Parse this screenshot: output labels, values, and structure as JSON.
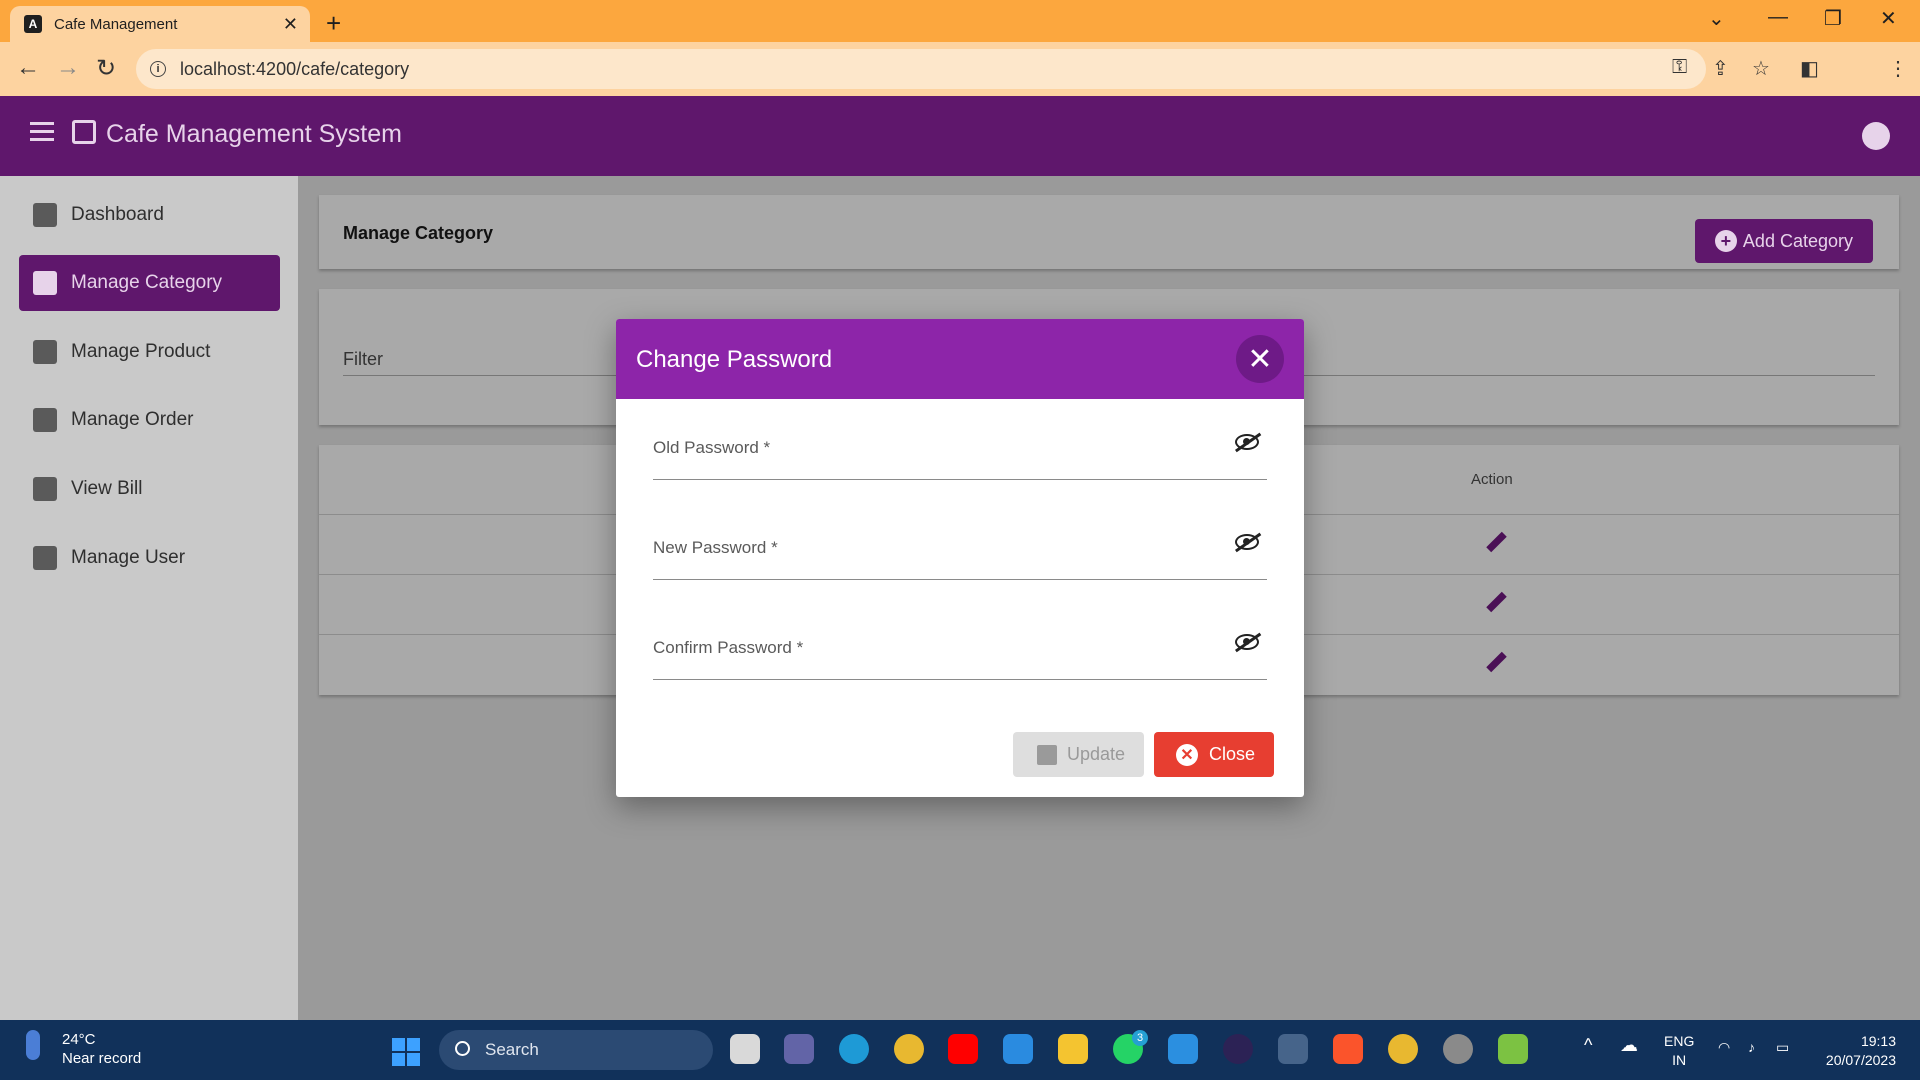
{
  "browser": {
    "tab_title": "Cafe Management",
    "url": "localhost:4200/cafe/category"
  },
  "app": {
    "title": "Cafe Management System",
    "brand_color": "#5f176c"
  },
  "sidebar": {
    "items": [
      {
        "label": "Dashboard",
        "icon": "dashboard-icon"
      },
      {
        "label": "Manage Category",
        "icon": "category-icon",
        "active": true
      },
      {
        "label": "Manage Product",
        "icon": "inventory-icon"
      },
      {
        "label": "Manage Order",
        "icon": "shopping-cart-icon"
      },
      {
        "label": "View Bill",
        "icon": "bill-icon"
      },
      {
        "label": "Manage User",
        "icon": "people-icon"
      }
    ]
  },
  "main": {
    "page_title": "Manage Category",
    "add_button": "Add Category",
    "filter_placeholder": "Filter",
    "table": {
      "action_header": "Action",
      "row_count": 3
    }
  },
  "dialog": {
    "title": "Change Password",
    "header_color": "#8d25a9",
    "fields": [
      {
        "label": "Old Password *"
      },
      {
        "label": "New Password *"
      },
      {
        "label": "Confirm Password *"
      }
    ],
    "update_label": "Update",
    "close_label": "Close",
    "close_color": "#e73e31"
  },
  "taskbar": {
    "weather_temp": "24°C",
    "weather_desc": "Near record",
    "search_label": "Search",
    "whatsapp_badge": "3",
    "lang_1": "ENG",
    "lang_2": "IN",
    "time": "19:13",
    "date": "20/07/2023"
  }
}
